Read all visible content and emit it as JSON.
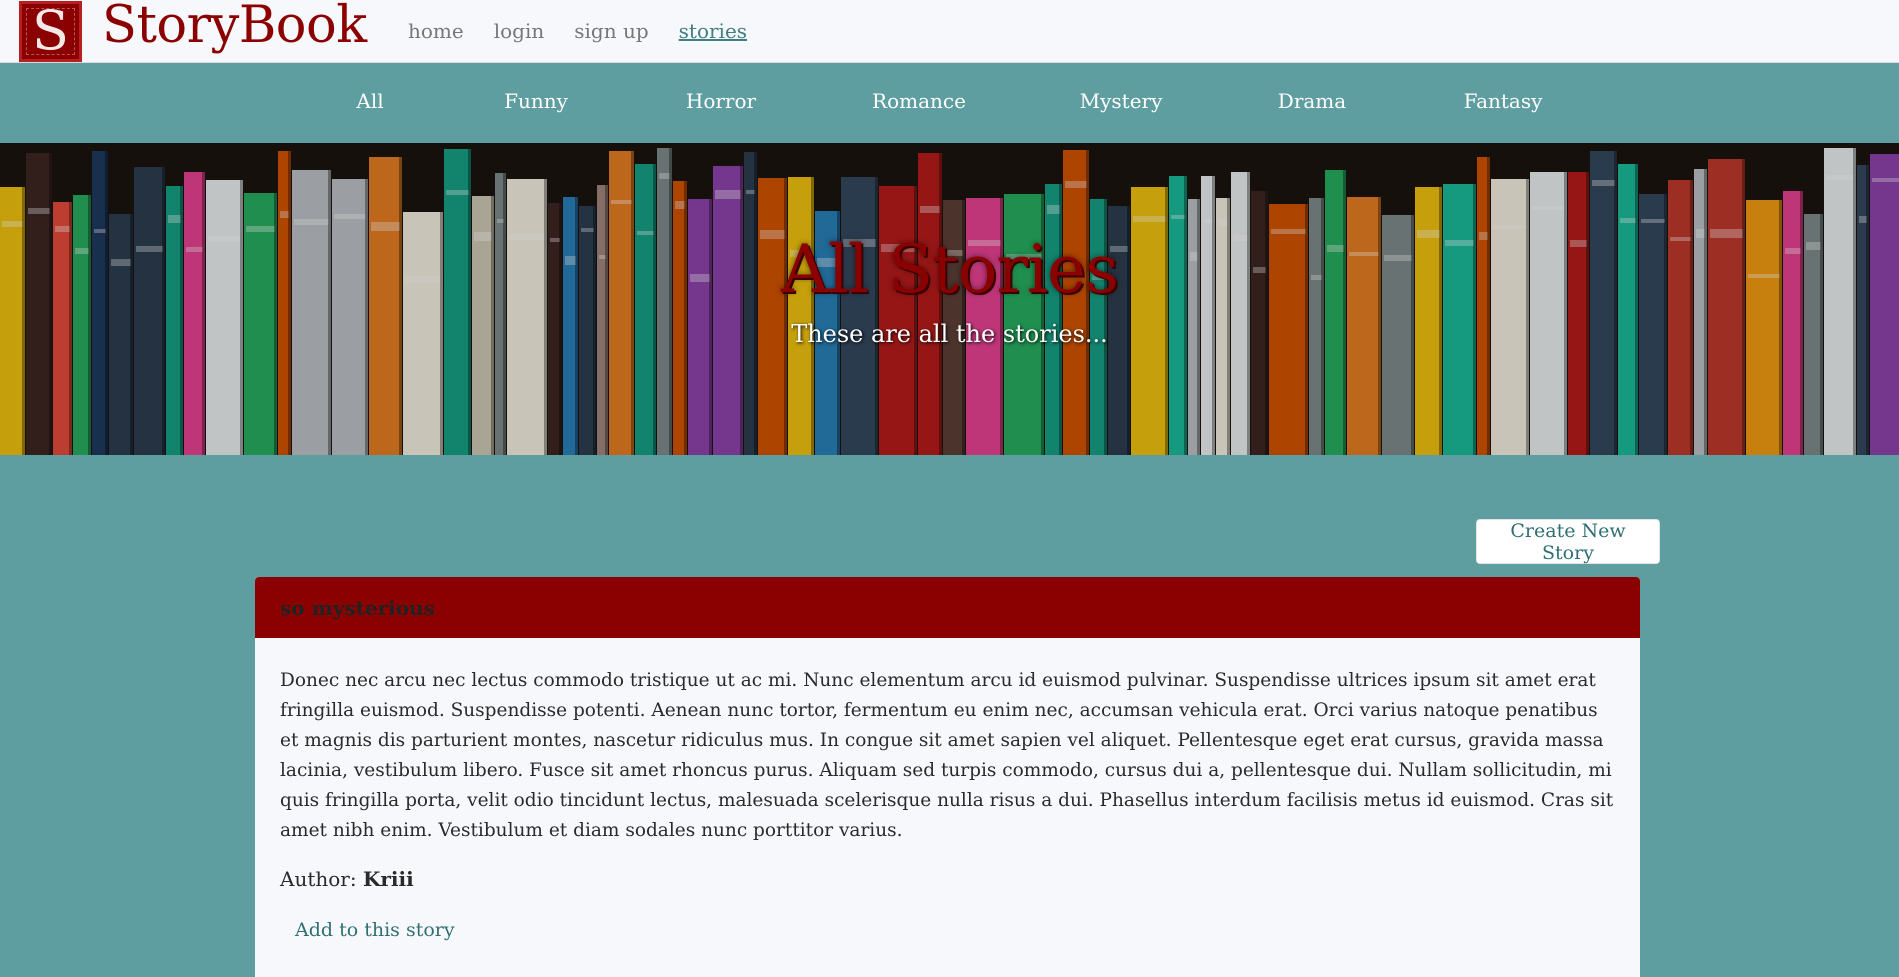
{
  "header": {
    "logo_letter": "S",
    "brand": "StoryBook",
    "nav": [
      {
        "label": "home",
        "active": false
      },
      {
        "label": "login",
        "active": false
      },
      {
        "label": "sign up",
        "active": false
      },
      {
        "label": "stories",
        "active": true
      }
    ]
  },
  "categories": [
    "All",
    "Funny",
    "Horror",
    "Romance",
    "Mystery",
    "Drama",
    "Fantasy"
  ],
  "hero": {
    "title": "All Stories",
    "subtitle": "These are all the stories..."
  },
  "actions": {
    "create_label": "Create New Story"
  },
  "story": {
    "title": "so mysterious",
    "body": "Donec nec arcu nec lectus commodo tristique ut ac mi. Nunc elementum arcu id euismod pulvinar. Suspendisse ultrices ipsum sit amet erat fringilla euismod. Suspendisse potenti. Aenean nunc tortor, fermentum eu enim nec, accumsan vehicula erat. Orci varius natoque penatibus et magnis dis parturient montes, nascetur ridiculus mus. In congue sit amet sapien vel aliquet. Pellentesque eget erat cursus, gravida massa lacinia, vestibulum libero. Fusce sit amet rhoncus purus. Aliquam sed turpis commodo, cursus dui a, pellentesque dui. Nullam sollicitudin, mi quis fringilla porta, velit odio tincidunt lectus, malesuada scelerisque nulla risus a dui. Phasellus interdum facilisis metus id euismod. Cras sit amet nibh enim. Vestibulum et diam sodales nunc porttitor varius.",
    "author_label": "Author:",
    "author": "Kriii",
    "add_link": "Add to this story"
  },
  "colors": {
    "accent": "#5f9ea0",
    "brand": "#8b0000",
    "link": "#2f6f72"
  }
}
